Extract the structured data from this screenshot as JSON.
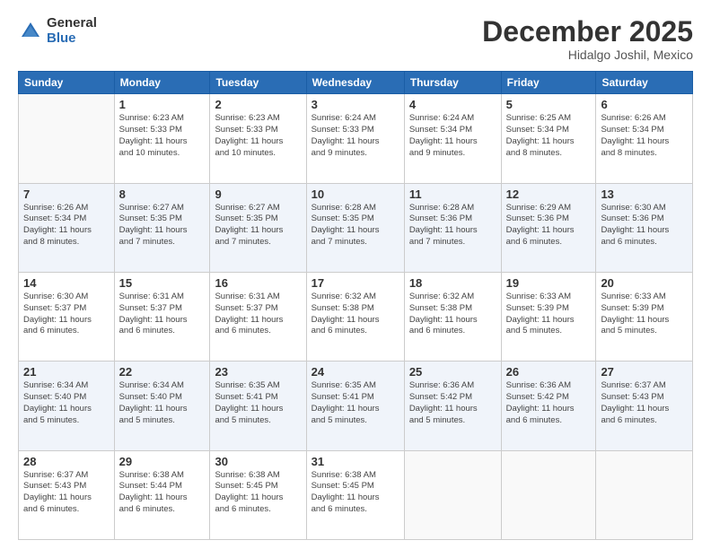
{
  "logo": {
    "general": "General",
    "blue": "Blue"
  },
  "title": "December 2025",
  "subtitle": "Hidalgo Joshil, Mexico",
  "days_of_week": [
    "Sunday",
    "Monday",
    "Tuesday",
    "Wednesday",
    "Thursday",
    "Friday",
    "Saturday"
  ],
  "weeks": [
    [
      {
        "day": "",
        "info": ""
      },
      {
        "day": "1",
        "info": "Sunrise: 6:23 AM\nSunset: 5:33 PM\nDaylight: 11 hours\nand 10 minutes."
      },
      {
        "day": "2",
        "info": "Sunrise: 6:23 AM\nSunset: 5:33 PM\nDaylight: 11 hours\nand 10 minutes."
      },
      {
        "day": "3",
        "info": "Sunrise: 6:24 AM\nSunset: 5:33 PM\nDaylight: 11 hours\nand 9 minutes."
      },
      {
        "day": "4",
        "info": "Sunrise: 6:24 AM\nSunset: 5:34 PM\nDaylight: 11 hours\nand 9 minutes."
      },
      {
        "day": "5",
        "info": "Sunrise: 6:25 AM\nSunset: 5:34 PM\nDaylight: 11 hours\nand 8 minutes."
      },
      {
        "day": "6",
        "info": "Sunrise: 6:26 AM\nSunset: 5:34 PM\nDaylight: 11 hours\nand 8 minutes."
      }
    ],
    [
      {
        "day": "7",
        "info": "Sunrise: 6:26 AM\nSunset: 5:34 PM\nDaylight: 11 hours\nand 8 minutes."
      },
      {
        "day": "8",
        "info": "Sunrise: 6:27 AM\nSunset: 5:35 PM\nDaylight: 11 hours\nand 7 minutes."
      },
      {
        "day": "9",
        "info": "Sunrise: 6:27 AM\nSunset: 5:35 PM\nDaylight: 11 hours\nand 7 minutes."
      },
      {
        "day": "10",
        "info": "Sunrise: 6:28 AM\nSunset: 5:35 PM\nDaylight: 11 hours\nand 7 minutes."
      },
      {
        "day": "11",
        "info": "Sunrise: 6:28 AM\nSunset: 5:36 PM\nDaylight: 11 hours\nand 7 minutes."
      },
      {
        "day": "12",
        "info": "Sunrise: 6:29 AM\nSunset: 5:36 PM\nDaylight: 11 hours\nand 6 minutes."
      },
      {
        "day": "13",
        "info": "Sunrise: 6:30 AM\nSunset: 5:36 PM\nDaylight: 11 hours\nand 6 minutes."
      }
    ],
    [
      {
        "day": "14",
        "info": "Sunrise: 6:30 AM\nSunset: 5:37 PM\nDaylight: 11 hours\nand 6 minutes."
      },
      {
        "day": "15",
        "info": "Sunrise: 6:31 AM\nSunset: 5:37 PM\nDaylight: 11 hours\nand 6 minutes."
      },
      {
        "day": "16",
        "info": "Sunrise: 6:31 AM\nSunset: 5:37 PM\nDaylight: 11 hours\nand 6 minutes."
      },
      {
        "day": "17",
        "info": "Sunrise: 6:32 AM\nSunset: 5:38 PM\nDaylight: 11 hours\nand 6 minutes."
      },
      {
        "day": "18",
        "info": "Sunrise: 6:32 AM\nSunset: 5:38 PM\nDaylight: 11 hours\nand 6 minutes."
      },
      {
        "day": "19",
        "info": "Sunrise: 6:33 AM\nSunset: 5:39 PM\nDaylight: 11 hours\nand 5 minutes."
      },
      {
        "day": "20",
        "info": "Sunrise: 6:33 AM\nSunset: 5:39 PM\nDaylight: 11 hours\nand 5 minutes."
      }
    ],
    [
      {
        "day": "21",
        "info": "Sunrise: 6:34 AM\nSunset: 5:40 PM\nDaylight: 11 hours\nand 5 minutes."
      },
      {
        "day": "22",
        "info": "Sunrise: 6:34 AM\nSunset: 5:40 PM\nDaylight: 11 hours\nand 5 minutes."
      },
      {
        "day": "23",
        "info": "Sunrise: 6:35 AM\nSunset: 5:41 PM\nDaylight: 11 hours\nand 5 minutes."
      },
      {
        "day": "24",
        "info": "Sunrise: 6:35 AM\nSunset: 5:41 PM\nDaylight: 11 hours\nand 5 minutes."
      },
      {
        "day": "25",
        "info": "Sunrise: 6:36 AM\nSunset: 5:42 PM\nDaylight: 11 hours\nand 5 minutes."
      },
      {
        "day": "26",
        "info": "Sunrise: 6:36 AM\nSunset: 5:42 PM\nDaylight: 11 hours\nand 6 minutes."
      },
      {
        "day": "27",
        "info": "Sunrise: 6:37 AM\nSunset: 5:43 PM\nDaylight: 11 hours\nand 6 minutes."
      }
    ],
    [
      {
        "day": "28",
        "info": "Sunrise: 6:37 AM\nSunset: 5:43 PM\nDaylight: 11 hours\nand 6 minutes."
      },
      {
        "day": "29",
        "info": "Sunrise: 6:38 AM\nSunset: 5:44 PM\nDaylight: 11 hours\nand 6 minutes."
      },
      {
        "day": "30",
        "info": "Sunrise: 6:38 AM\nSunset: 5:45 PM\nDaylight: 11 hours\nand 6 minutes."
      },
      {
        "day": "31",
        "info": "Sunrise: 6:38 AM\nSunset: 5:45 PM\nDaylight: 11 hours\nand 6 minutes."
      },
      {
        "day": "",
        "info": ""
      },
      {
        "day": "",
        "info": ""
      },
      {
        "day": "",
        "info": ""
      }
    ]
  ]
}
